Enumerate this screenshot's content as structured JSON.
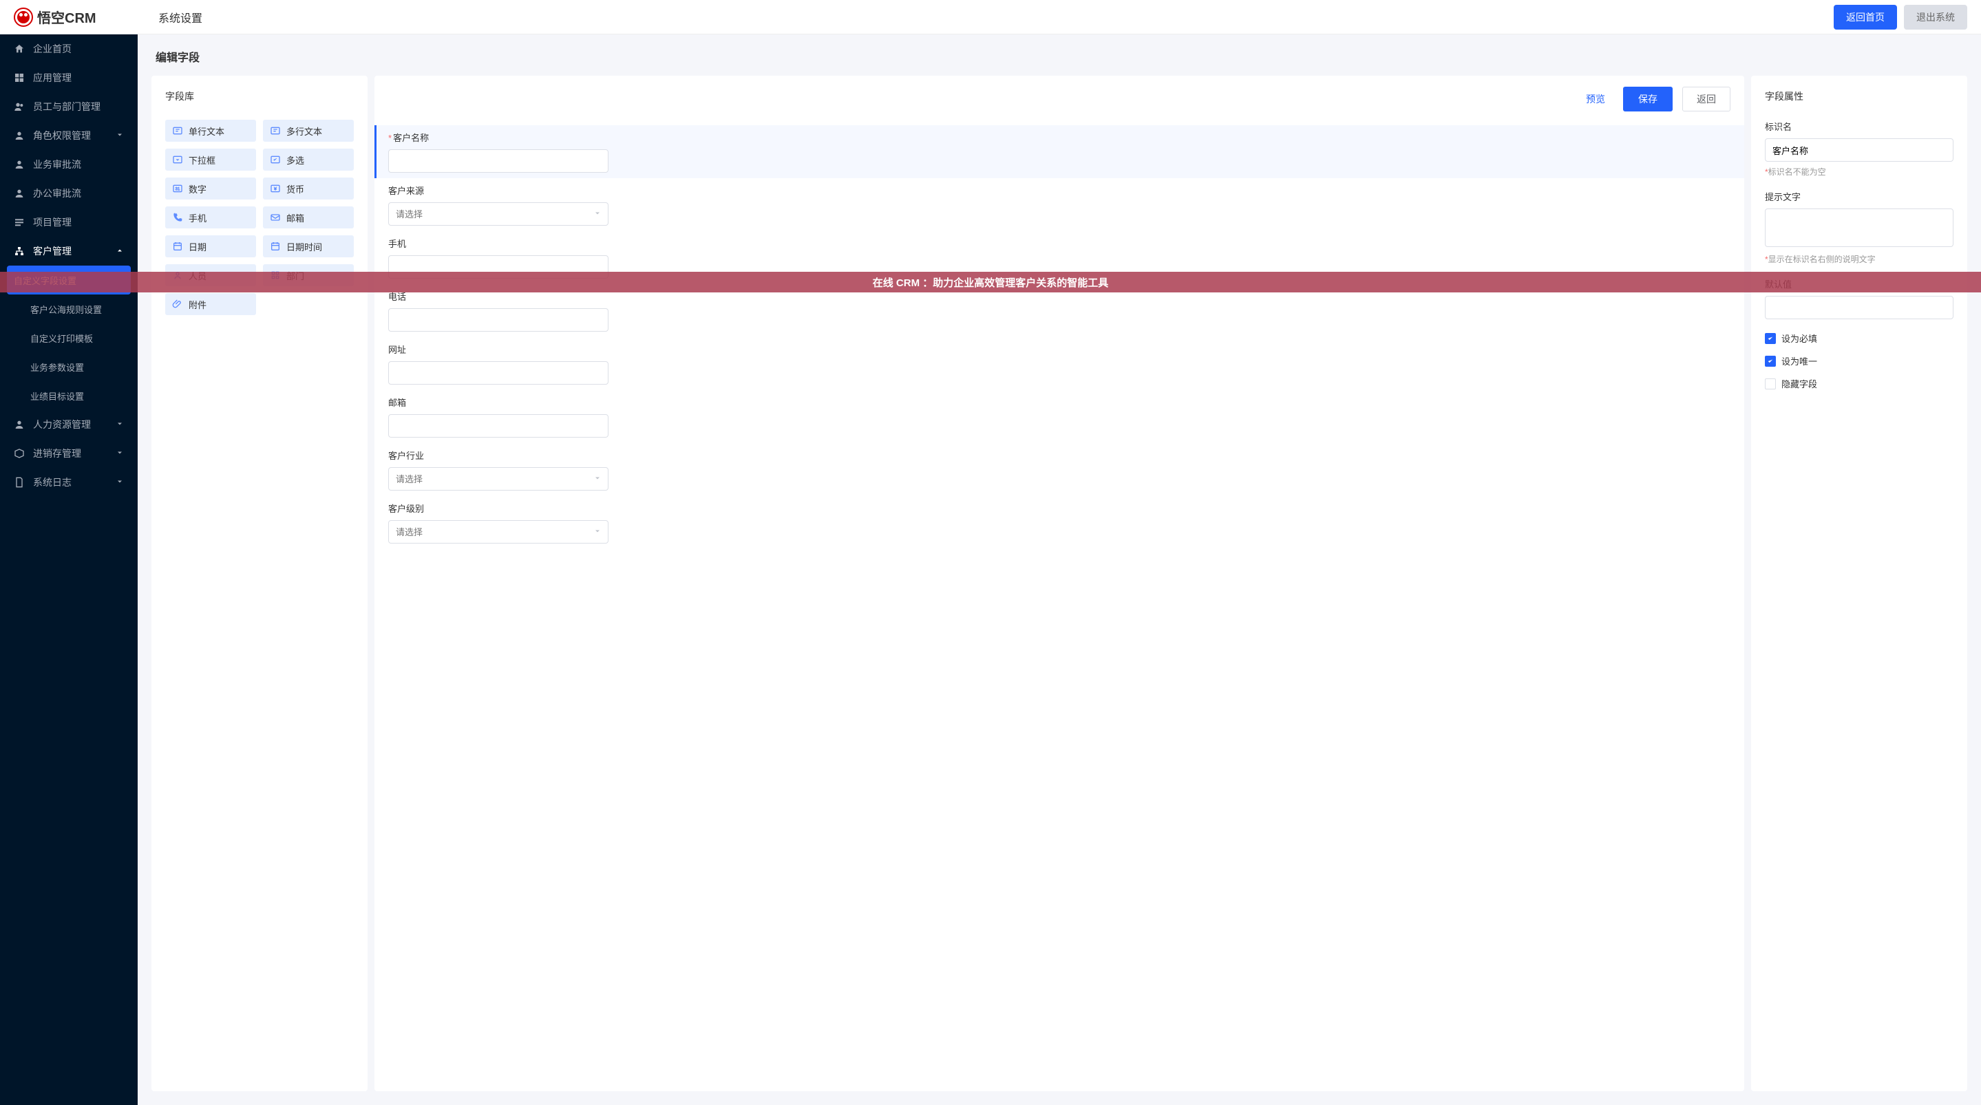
{
  "brand": "悟空CRM",
  "topbar": {
    "title": "系统设置",
    "home_btn": "返回首页",
    "logout_btn": "退出系统"
  },
  "sidebar": {
    "items": [
      {
        "label": "企业首页",
        "icon": "home"
      },
      {
        "label": "应用管理",
        "icon": "grid"
      },
      {
        "label": "员工与部门管理",
        "icon": "users"
      },
      {
        "label": "角色权限管理",
        "icon": "user",
        "chevron": "down"
      },
      {
        "label": "业务审批流",
        "icon": "user"
      },
      {
        "label": "办公审批流",
        "icon": "user"
      },
      {
        "label": "项目管理",
        "icon": "bars"
      },
      {
        "label": "客户管理",
        "icon": "sitemap",
        "chevron": "up",
        "open": true,
        "children": [
          {
            "label": "自定义字段设置",
            "active": true
          },
          {
            "label": "客户公海规则设置"
          },
          {
            "label": "自定义打印模板"
          },
          {
            "label": "业务参数设置"
          },
          {
            "label": "业绩目标设置"
          }
        ]
      },
      {
        "label": "人力资源管理",
        "icon": "user",
        "chevron": "down"
      },
      {
        "label": "进销存管理",
        "icon": "box",
        "chevron": "down"
      },
      {
        "label": "系统日志",
        "icon": "file",
        "chevron": "down"
      }
    ]
  },
  "page": {
    "title": "编辑字段"
  },
  "library": {
    "title": "字段库",
    "tiles": [
      {
        "icon": "text",
        "label": "单行文本"
      },
      {
        "icon": "text",
        "label": "多行文本"
      },
      {
        "icon": "caret",
        "label": "下拉框"
      },
      {
        "icon": "check",
        "label": "多选"
      },
      {
        "icon": "num",
        "label": "数字"
      },
      {
        "icon": "money",
        "label": "货币"
      },
      {
        "icon": "phone",
        "label": "手机"
      },
      {
        "icon": "mail",
        "label": "邮箱"
      },
      {
        "icon": "cal",
        "label": "日期"
      },
      {
        "icon": "cal",
        "label": "日期时间"
      },
      {
        "icon": "person",
        "label": "人员"
      },
      {
        "icon": "org",
        "label": "部门"
      },
      {
        "icon": "clip",
        "label": "附件"
      }
    ]
  },
  "editor": {
    "actions": {
      "preview": "预览",
      "save": "保存",
      "back": "返回"
    },
    "fields": [
      {
        "label": "客户名称",
        "required": true,
        "type": "text",
        "selected": true
      },
      {
        "label": "客户来源",
        "type": "select",
        "placeholder": "请选择"
      },
      {
        "label": "手机",
        "type": "text"
      },
      {
        "label": "电话",
        "type": "text"
      },
      {
        "label": "网址",
        "type": "text"
      },
      {
        "label": "邮箱",
        "type": "text"
      },
      {
        "label": "客户行业",
        "type": "select",
        "placeholder": "请选择"
      },
      {
        "label": "客户级别",
        "type": "select",
        "placeholder": "请选择"
      }
    ]
  },
  "props": {
    "title": "字段属性",
    "id_label": "标识名",
    "id_value": "客户名称",
    "id_hint": "标识名不能为空",
    "tip_label": "提示文字",
    "tip_hint": "显示在标识名右侧的说明文字",
    "default_label": "默认值",
    "checks": [
      {
        "label": "设为必填",
        "checked": true
      },
      {
        "label": "设为唯一",
        "checked": true
      },
      {
        "label": "隐藏字段",
        "checked": false
      }
    ]
  },
  "banner": "在线 CRM ：助力企业高效管理客户关系的智能工具"
}
